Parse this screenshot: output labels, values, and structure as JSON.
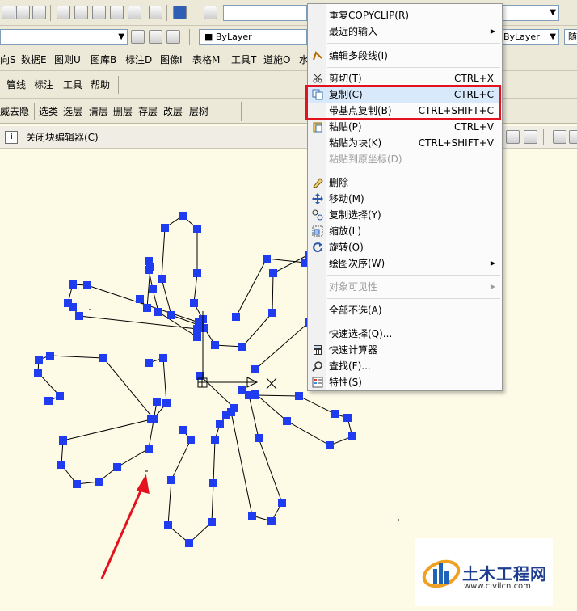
{
  "toolbar": {
    "layer_combo": "■ ByLayer",
    "linetype_combo": "ByLayer",
    "right_stub": "随"
  },
  "menubar": {
    "items": [
      "向S",
      "数据E",
      "图则U",
      "图库B",
      "标注D",
      "图像I",
      "表格M",
      "工具T",
      "道施O",
      "水"
    ]
  },
  "toolbar2": {
    "items": [
      "管线",
      "标注",
      "工具",
      "帮助"
    ]
  },
  "layer_toolbar": {
    "items": [
      "选类",
      "选层",
      "清层",
      "删层",
      "存层",
      "改层",
      "层树"
    ],
    "left_stub": "威",
    "left_stub2": "去隐"
  },
  "block_editor": {
    "close_label": "关闭块编辑器(C)"
  },
  "context_menu": {
    "items": [
      {
        "label": "重复COPYCLIP(R)",
        "shortcut": ""
      },
      {
        "label": "最近的输入",
        "shortcut": ""
      },
      {
        "label": "编辑多段线(I)",
        "shortcut": ""
      },
      {
        "label": "剪切(T)",
        "shortcut": "CTRL+X"
      },
      {
        "label": "复制(C)",
        "shortcut": "CTRL+C"
      },
      {
        "label": "带基点复制(B)",
        "shortcut": "CTRL+SHIFT+C"
      },
      {
        "label": "粘贴(P)",
        "shortcut": "CTRL+V"
      },
      {
        "label": "粘贴为块(K)",
        "shortcut": "CTRL+SHIFT+V"
      },
      {
        "label": "粘贴到原坐标(D)",
        "shortcut": ""
      },
      {
        "label": "删除",
        "shortcut": ""
      },
      {
        "label": "移动(M)",
        "shortcut": ""
      },
      {
        "label": "复制选择(Y)",
        "shortcut": ""
      },
      {
        "label": "缩放(L)",
        "shortcut": ""
      },
      {
        "label": "旋转(O)",
        "shortcut": ""
      },
      {
        "label": "绘图次序(W)",
        "shortcut": ""
      },
      {
        "label": "对象可见性",
        "shortcut": ""
      },
      {
        "label": "全部不选(A)",
        "shortcut": ""
      },
      {
        "label": "快速选择(Q)...",
        "shortcut": ""
      },
      {
        "label": "快速计算器",
        "shortcut": ""
      },
      {
        "label": "查找(F)...",
        "shortcut": ""
      },
      {
        "label": "特性(S)",
        "shortcut": ""
      }
    ],
    "highlight_color": "#d7e9fb",
    "callout_color": "#e3121e"
  },
  "watermark": {
    "title": "土木工程网",
    "url": "www.civilcn.com"
  }
}
